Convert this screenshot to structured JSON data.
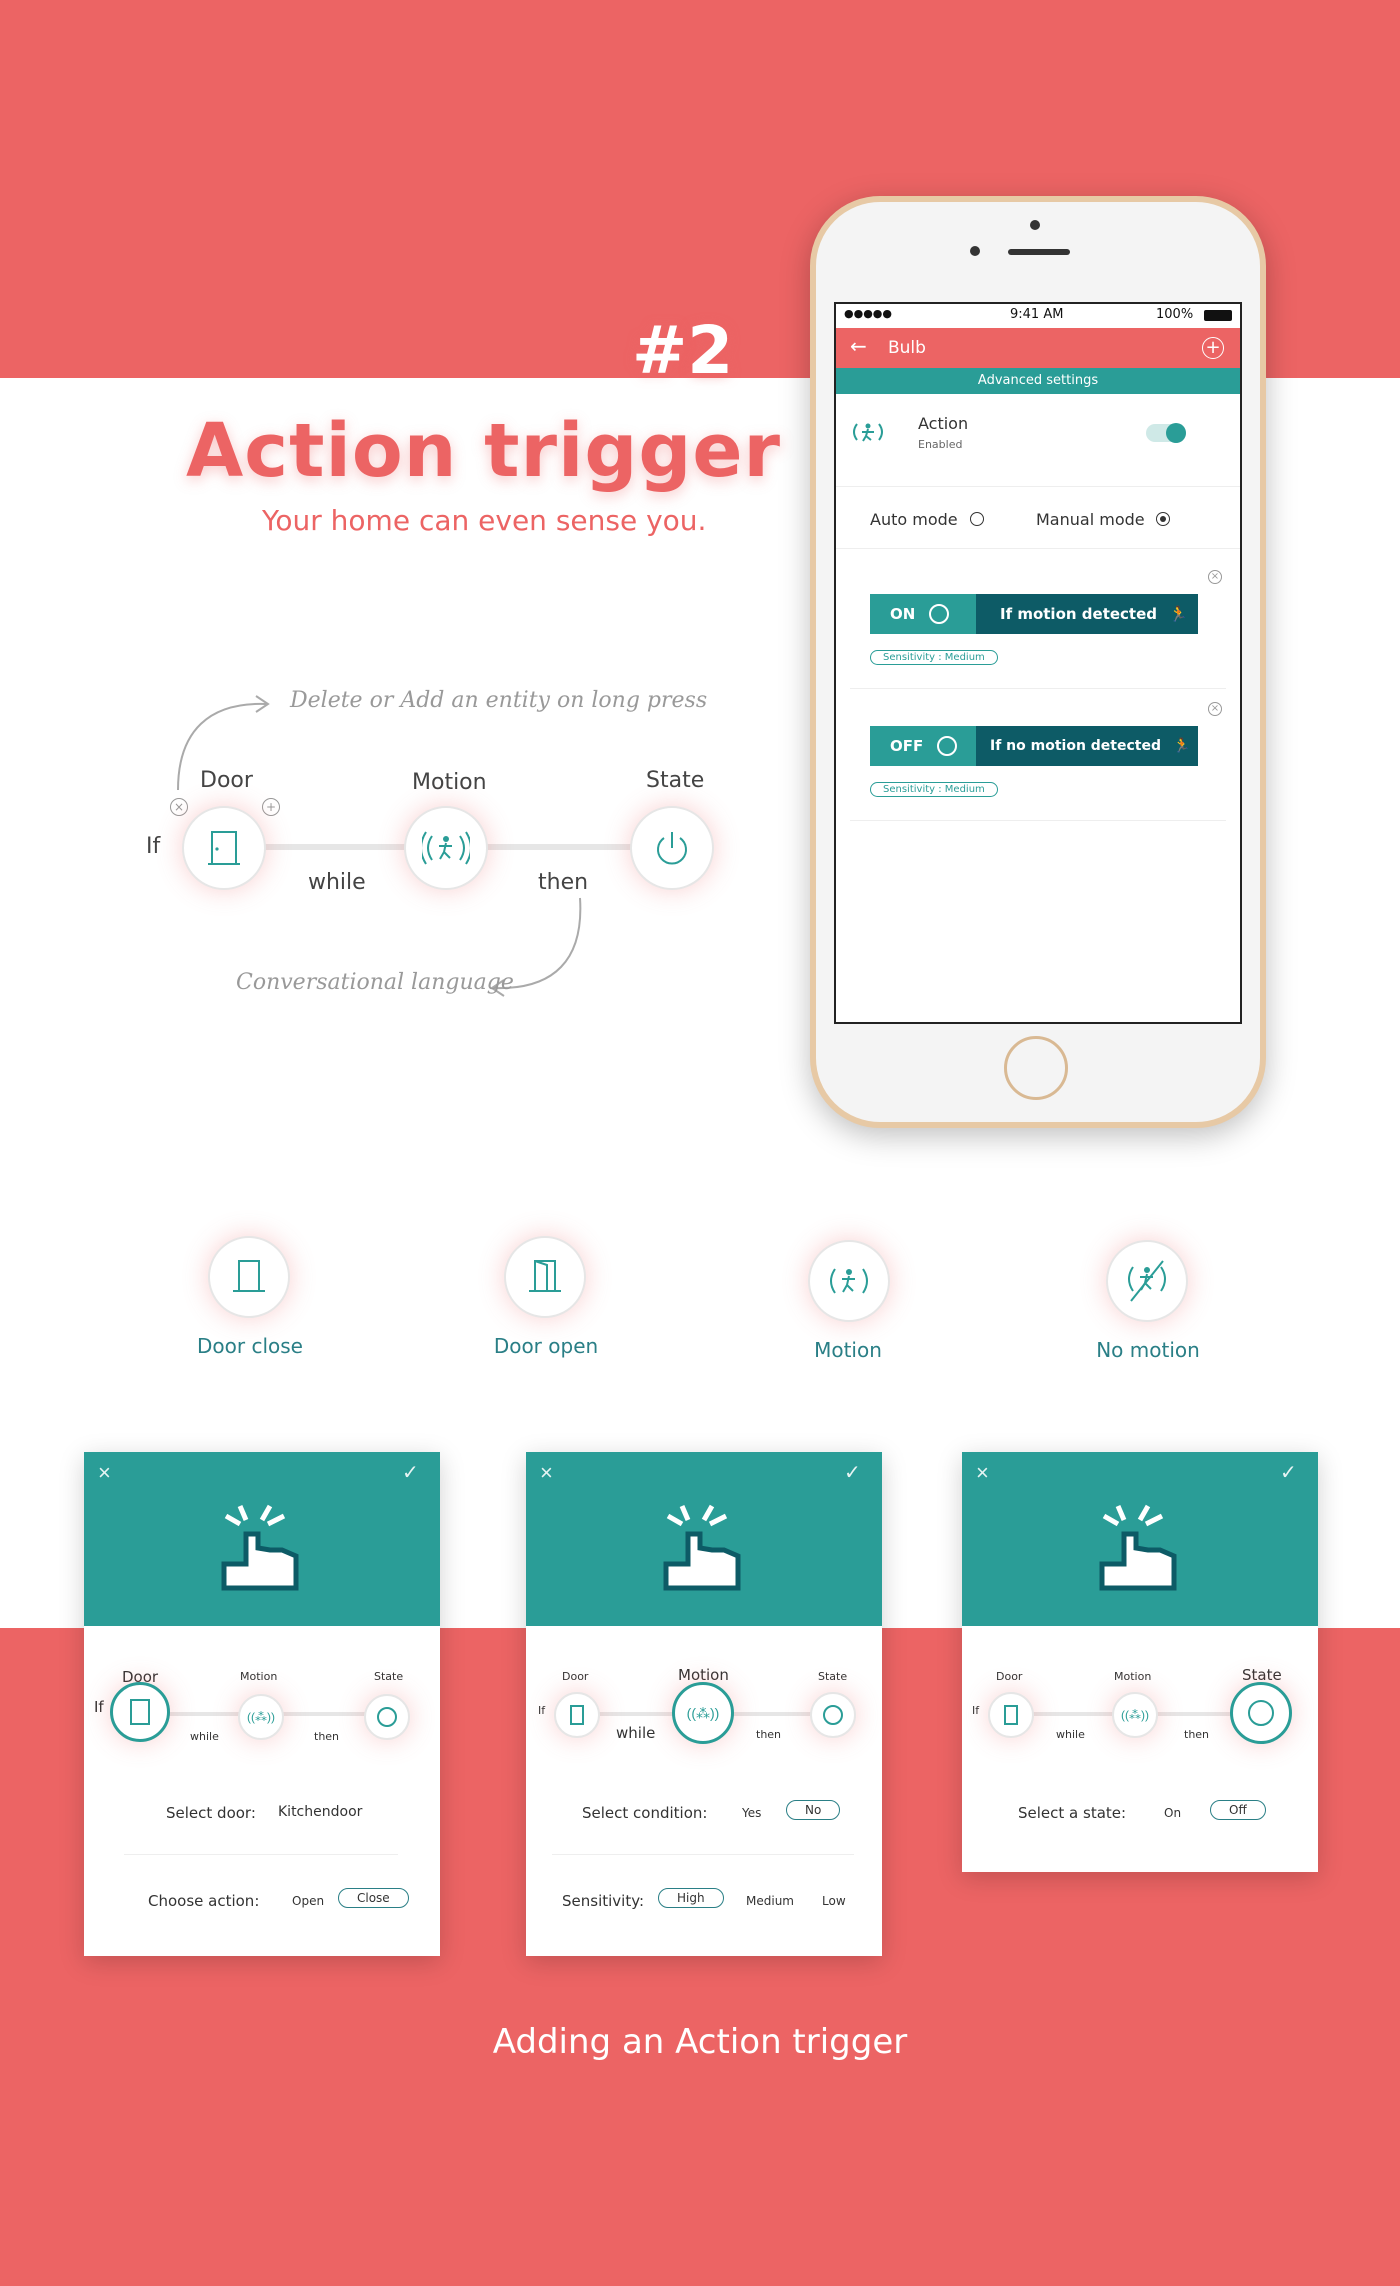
{
  "header": {
    "number": "#2",
    "title": "Action trigger",
    "subtitle": "Your home can even sense you."
  },
  "diagram": {
    "if_label": "If",
    "door_label": "Door",
    "motion_label": "Motion",
    "state_label": "State",
    "while_label": "while",
    "then_label": "then",
    "note_top": "Delete or Add an entity on long press",
    "note_bottom": "Conversational language"
  },
  "phone": {
    "status": {
      "signal": "●●●●●",
      "time": "9:41 AM",
      "battery": "100%"
    },
    "appbar_title": "Bulb",
    "subbar": "Advanced settings",
    "action_title": "Action",
    "action_status": "Enabled",
    "auto_mode": "Auto mode",
    "manual_mode": "Manual mode",
    "triggers": [
      {
        "state": "ON",
        "condition": "If motion detected",
        "sensitivity": "Sensitivity : Medium"
      },
      {
        "state": "OFF",
        "condition": "If no motion detected",
        "sensitivity": "Sensitivity : Medium"
      }
    ]
  },
  "icons_row": [
    {
      "label": "Door close",
      "icon": "door-close-icon"
    },
    {
      "label": "Door open",
      "icon": "door-open-icon"
    },
    {
      "label": "Motion",
      "icon": "motion-icon"
    },
    {
      "label": "No motion",
      "icon": "no-motion-icon"
    }
  ],
  "cards": [
    {
      "mini": {
        "door": "Door",
        "motion": "Motion",
        "state": "State",
        "if": "If",
        "while": "while",
        "then": "then"
      },
      "row1_label": "Select door:",
      "row1_value": "Kitchendoor",
      "row2_label": "Choose action:",
      "row2_opt1": "Open",
      "row2_opt2": "Close"
    },
    {
      "mini": {
        "door": "Door",
        "motion": "Motion",
        "state": "State",
        "if": "If",
        "while": "while",
        "then": "then"
      },
      "row1_label": "Select condition:",
      "row1_opt1": "Yes",
      "row1_opt2": "No",
      "row2_label": "Sensitivity:",
      "row2_opt1": "High",
      "row2_opt2": "Medium",
      "row2_opt3": "Low"
    },
    {
      "mini": {
        "door": "Door",
        "motion": "Motion",
        "state": "State",
        "if": "If",
        "while": "while",
        "then": "then"
      },
      "row1_label": "Select a state:",
      "row1_opt1": "On",
      "row1_opt2": "Off"
    }
  ],
  "caption": "Adding an Action trigger",
  "colors": {
    "accent": "#ec6464",
    "teal": "#2a9d97",
    "dark_teal": "#0d5b66"
  }
}
